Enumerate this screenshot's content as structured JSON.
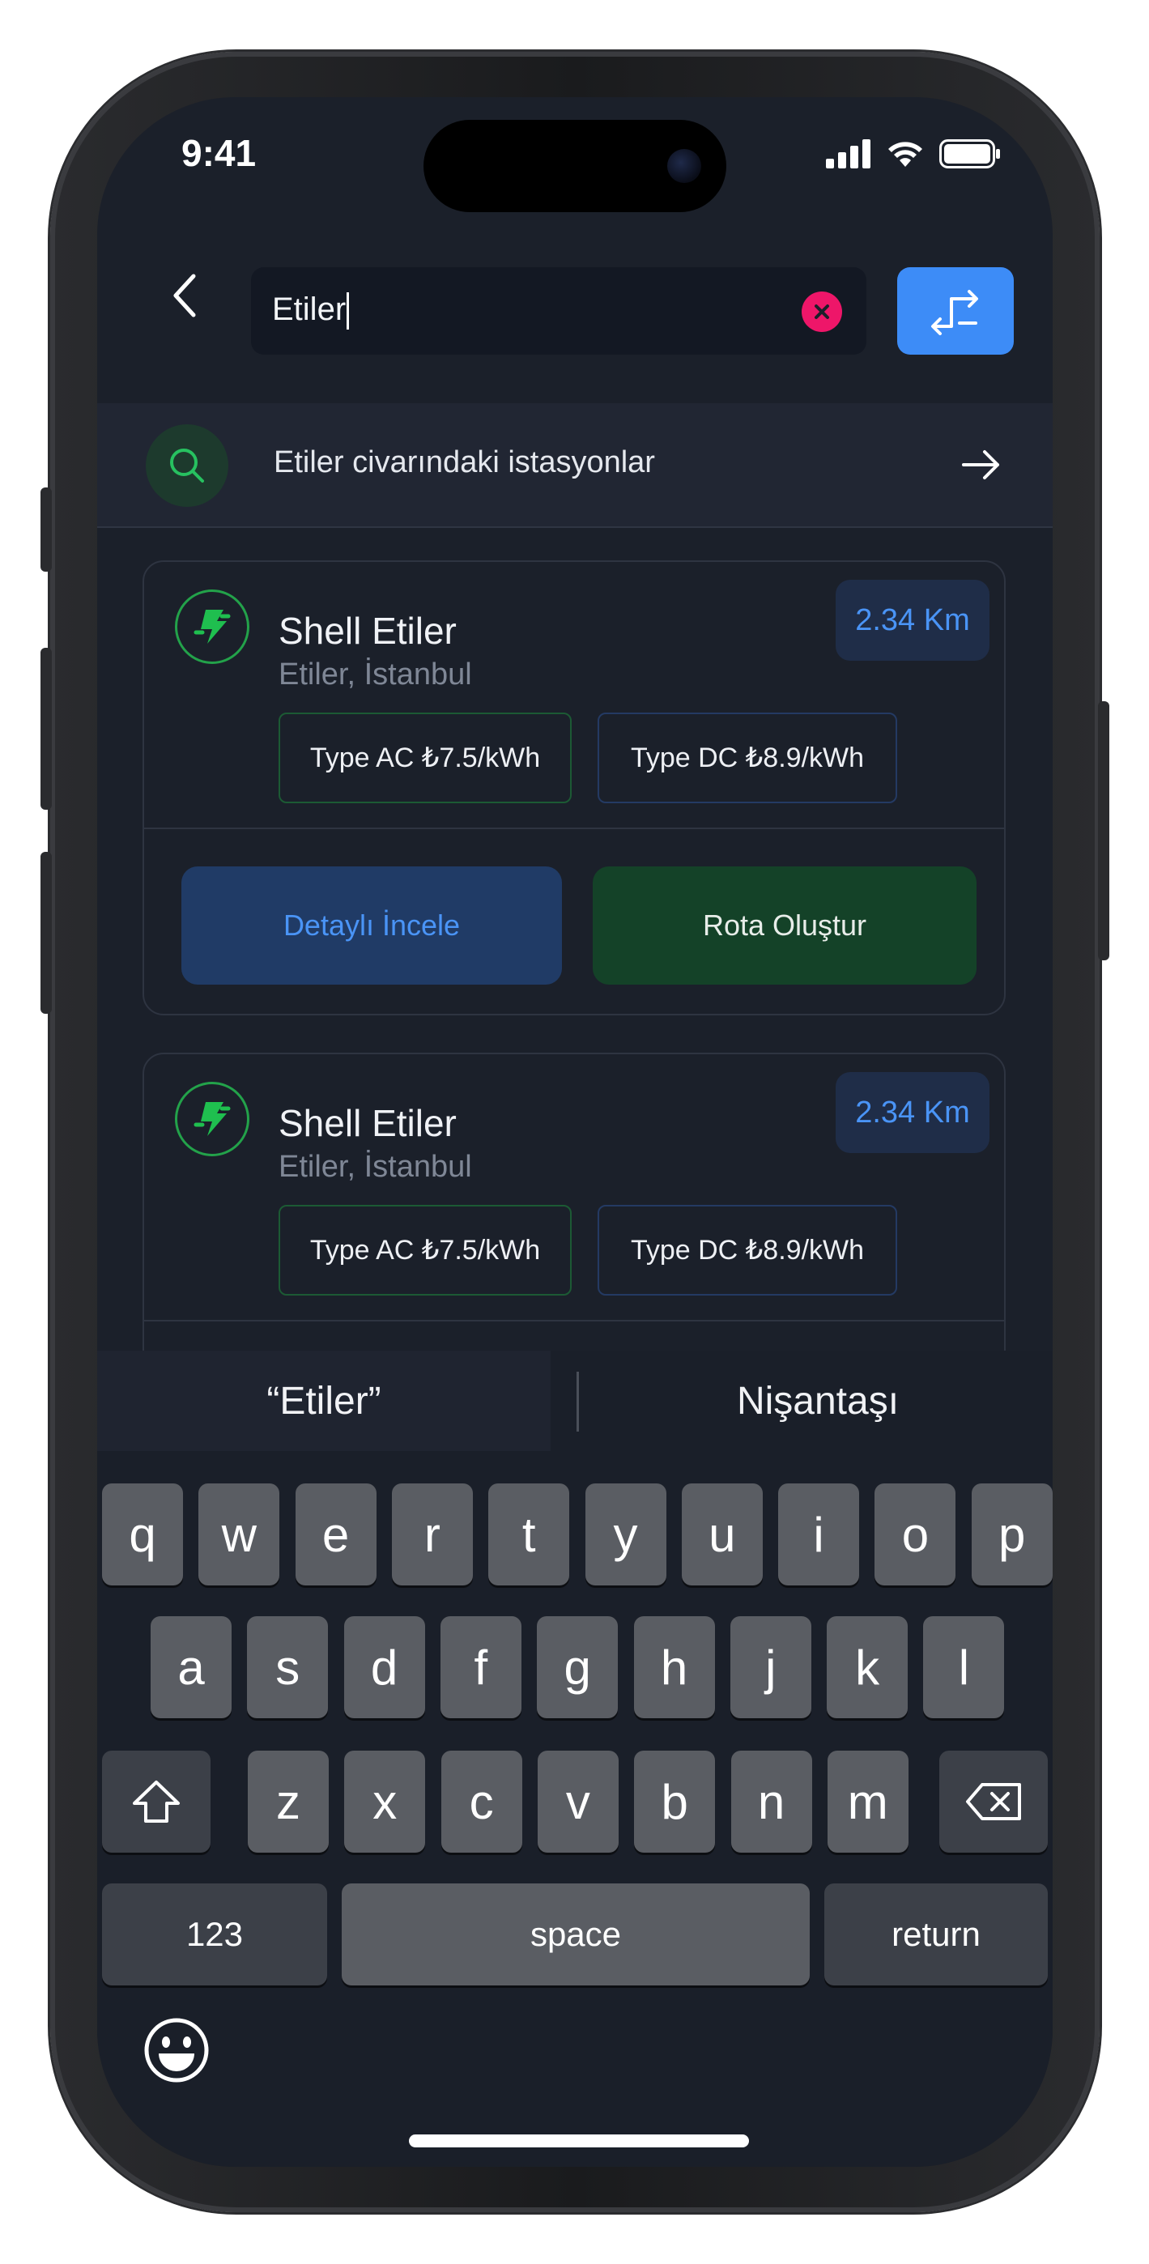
{
  "status_bar": {
    "time": "9:41"
  },
  "search": {
    "query": "Etiler"
  },
  "suggestion": {
    "text": "Etiler civarındaki istasyonlar"
  },
  "cards": [
    {
      "title": "Shell Etiler",
      "subtitle": "Etiler, İstanbul",
      "distance": "2.34 Km",
      "tag_ac": "Type AC ₺7.5/kWh",
      "tag_dc": "Type DC ₺8.9/kWh",
      "detail_label": "Detaylı İncele",
      "route_label": "Rota Oluştur"
    },
    {
      "title": "Shell Etiler",
      "subtitle": "Etiler, İstanbul",
      "distance": "2.34 Km",
      "tag_ac": "Type AC ₺7.5/kWh",
      "tag_dc": "Type DC ₺8.9/kWh"
    }
  ],
  "keyboard": {
    "predictions": [
      "“Etiler”",
      "Nişantaşı"
    ],
    "row1": [
      "q",
      "w",
      "e",
      "r",
      "t",
      "y",
      "u",
      "i",
      "o",
      "p"
    ],
    "row2": [
      "a",
      "s",
      "d",
      "f",
      "g",
      "h",
      "j",
      "k",
      "l"
    ],
    "row3": [
      "z",
      "x",
      "c",
      "v",
      "b",
      "n",
      "m"
    ],
    "numbers_label": "123",
    "space_label": "space",
    "return_label": "return"
  },
  "colors": {
    "accent_blue": "#3d8cf7",
    "accent_green": "#23a24a",
    "clear_pink": "#ee1669",
    "screen_bg": "#1b202a"
  }
}
